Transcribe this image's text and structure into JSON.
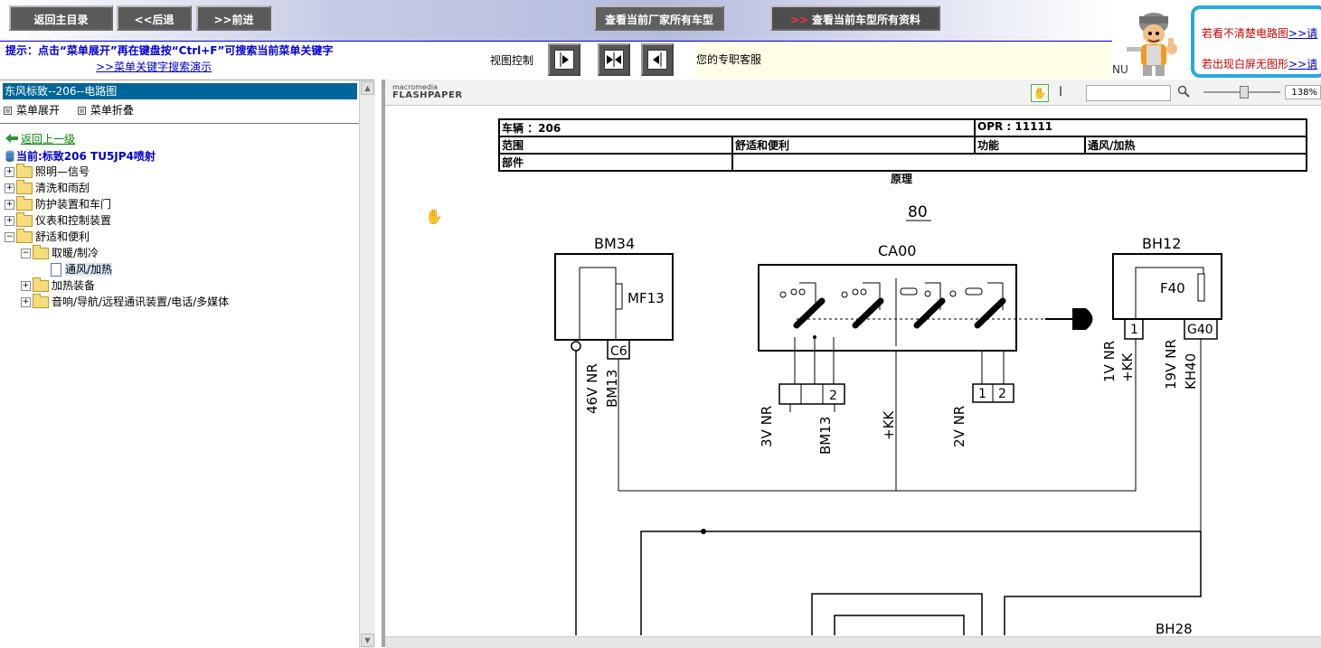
{
  "toolbar": {
    "home_label": "返回主目录",
    "back_label": "<<后退",
    "forward_label": ">>前进",
    "maker_models_label": "查看当前厂家所有车型",
    "all_data_label": "查看当前车型所有资料",
    "hint_text": "提示：点击“菜单展开”再在键盘按“Ctrl+F”可搜索当前菜单关键字",
    "hint_link": ">>菜单关键字搜索演示",
    "view_control_label": "视图控制",
    "customer_service": "您的专职客服",
    "nu_text": "NU"
  },
  "help": {
    "line1": "若看不清楚电路图",
    "line1_link": ">>请",
    "line2": "若出现白屏无图形",
    "line2_link": ">>请"
  },
  "menu": {
    "title": "东风标致--206--电路图",
    "expand_label": "菜单展开",
    "collapse_label": "菜单折叠",
    "back_up": "返回上一级",
    "current": "当前:标致206 TU5JP4喷射",
    "items": [
      {
        "label": "照明—信号",
        "sign": "+"
      },
      {
        "label": "清洗和雨刮",
        "sign": "+"
      },
      {
        "label": "防护装置和车门",
        "sign": "+"
      },
      {
        "label": "仪表和控制装置",
        "sign": "+"
      },
      {
        "label": "舒适和便利",
        "sign": "−"
      }
    ],
    "sub_items": [
      {
        "label": "取暖/制冷",
        "sign": "−"
      },
      {
        "label": "加热装备",
        "sign": "+"
      },
      {
        "label": "音响/导航/远程通讯装置/电话/多媒体",
        "sign": "+"
      }
    ],
    "leaf": "通风/加热"
  },
  "viewer": {
    "logo_top": "macromedia",
    "logo_bottom": "FLASHPAPER",
    "zoom": "138%"
  },
  "document": {
    "vehicle": "车辆 ：206",
    "opr": "OPR : 11111",
    "range_label": "范围",
    "range_value": "舒适和便利",
    "function_label": "功能",
    "function_value": "通风/加热",
    "part_label": "部件",
    "principle": "原理"
  },
  "schematic": {
    "page_number": "80",
    "bm34": "BM34",
    "mf13": "MF13",
    "c6": "C6",
    "ca00": "CA00",
    "bh12": "BH12",
    "f40": "F40",
    "pin1": "1",
    "g40": "G40",
    "wire_bm34": "46V NR",
    "wire_bm34b": "BM13",
    "conn_3v": "3V NR",
    "conn_bm13": "BM13",
    "conn_2": "2",
    "wire_kk": "+KK",
    "conn_2v": "2V NR",
    "conn_1": "1",
    "conn_2b": "2",
    "wire_1v": "1V NR",
    "wire_kk2": "+KK",
    "wire_19v": "19V NR",
    "wire_kh40": "KH40",
    "bh28": "BH28"
  }
}
